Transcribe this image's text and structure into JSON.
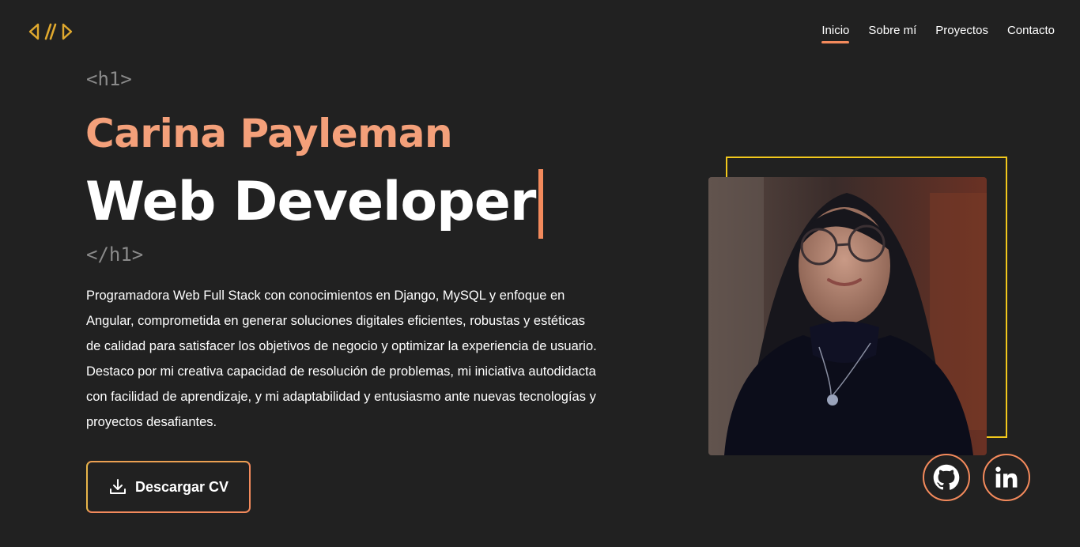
{
  "header": {
    "logo_icon": "code-brackets-icon",
    "nav": [
      {
        "label": "Inicio",
        "active": true
      },
      {
        "label": "Sobre mí",
        "active": false
      },
      {
        "label": "Proyectos",
        "active": false
      },
      {
        "label": "Contacto",
        "active": false
      }
    ]
  },
  "hero": {
    "tag_open": "<h1>",
    "name": "Carina Payleman",
    "role": "Web Developer",
    "tag_close": "</h1>",
    "description": "Programadora Web Full Stack con conocimientos en Django, MySQL y enfoque en Angular, comprometida en generar soluciones digitales eficientes, robustas y estéticas de calidad para satisfacer los objetivos de negocio y optimizar la experiencia de usuario. Destaco por mi creativa capacidad de resolución de problemas, mi iniciativa autodidacta con facilidad de aprendizaje, y mi adaptabilidad y entusiasmo ante nuevas tecnologías y proyectos desafiantes.",
    "cv_button": {
      "label": "Descargar CV",
      "icon": "download-icon"
    }
  },
  "social": [
    {
      "icon": "github-icon"
    },
    {
      "icon": "linkedin-icon"
    }
  ],
  "colors": {
    "background": "#212121",
    "accent": "#f38a5c",
    "name": "#f4a07a",
    "frame": "#f2c81c",
    "logo": "#e0a92e"
  }
}
